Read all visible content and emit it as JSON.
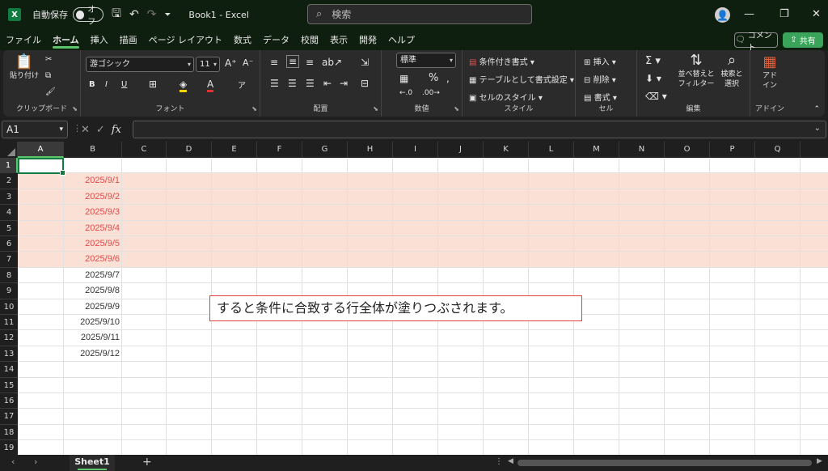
{
  "titlebar": {
    "app_icon": "excel-icon",
    "autosave_label": "自動保存",
    "autosave_state": "オフ",
    "doc_title": "Book1  -  Excel",
    "search_placeholder": "検索"
  },
  "menu_tabs": [
    "ファイル",
    "ホーム",
    "挿入",
    "描画",
    "ページ レイアウト",
    "数式",
    "データ",
    "校閲",
    "表示",
    "開発",
    "ヘルプ"
  ],
  "active_tab": "ホーム",
  "comment_label": "コメント",
  "share_label": "共有",
  "ribbon": {
    "clipboard": {
      "label": "クリップボード",
      "paste": "貼り付け"
    },
    "font": {
      "label": "フォント",
      "font_name": "游ゴシック",
      "font_size": "11"
    },
    "alignment": {
      "label": "配置"
    },
    "number": {
      "label": "数値",
      "format": "標準"
    },
    "styles": {
      "label": "スタイル",
      "conditional": "条件付き書式",
      "table": "テーブルとして書式設定",
      "cell_styles": "セルのスタイル"
    },
    "cells": {
      "label": "セル",
      "insert": "挿入",
      "delete": "削除",
      "format": "書式"
    },
    "editing": {
      "label": "編集",
      "sort": "並べ替えと",
      "sort2": "フィルター",
      "find": "検索と",
      "find2": "選択"
    },
    "addins": {
      "label": "アドイン",
      "btn1": "アド",
      "btn2": "イン"
    }
  },
  "formula_bar": {
    "name_box": "A1",
    "fx": "fx",
    "value": ""
  },
  "columns": [
    "A",
    "B",
    "C",
    "D",
    "E",
    "F",
    "G",
    "H",
    "I",
    "J",
    "K",
    "L",
    "M",
    "N",
    "O",
    "P",
    "Q"
  ],
  "selected_column": "A",
  "rows": [
    {
      "n": "1",
      "b": "",
      "hl": false
    },
    {
      "n": "2",
      "b": "2025/9/1",
      "hl": true
    },
    {
      "n": "3",
      "b": "2025/9/2",
      "hl": true
    },
    {
      "n": "4",
      "b": "2025/9/3",
      "hl": true
    },
    {
      "n": "5",
      "b": "2025/9/4",
      "hl": true
    },
    {
      "n": "6",
      "b": "2025/9/5",
      "hl": true
    },
    {
      "n": "7",
      "b": "2025/9/6",
      "hl": true
    },
    {
      "n": "8",
      "b": "2025/9/7",
      "hl": false
    },
    {
      "n": "9",
      "b": "2025/9/8",
      "hl": false
    },
    {
      "n": "10",
      "b": "2025/9/9",
      "hl": false
    },
    {
      "n": "11",
      "b": "2025/9/10",
      "hl": false
    },
    {
      "n": "12",
      "b": "2025/9/11",
      "hl": false
    },
    {
      "n": "13",
      "b": "2025/9/12",
      "hl": false
    },
    {
      "n": "14",
      "b": "",
      "hl": false
    },
    {
      "n": "15",
      "b": "",
      "hl": false
    },
    {
      "n": "16",
      "b": "",
      "hl": false
    },
    {
      "n": "17",
      "b": "",
      "hl": false
    },
    {
      "n": "18",
      "b": "",
      "hl": false
    },
    {
      "n": "19",
      "b": "",
      "hl": false
    }
  ],
  "annotation": "すると条件に合致する行全体が塗りつぶされます。",
  "sheet_tab": "Sheet1",
  "colors": {
    "highlight_fill": "#fbe1d5",
    "highlight_text": "#e04b4b",
    "accent": "#5ec46b",
    "excel_green": "#107c41"
  }
}
